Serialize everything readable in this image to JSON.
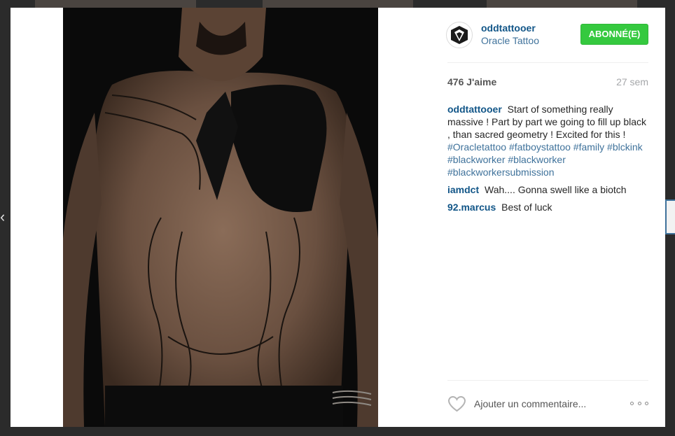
{
  "post": {
    "username": "oddtattooer",
    "location": "Oracle Tattoo",
    "follow_label": "ABONNÉ(E)",
    "likes": "476 J'aime",
    "time": "27 sem",
    "caption": {
      "user": "oddtattooer",
      "text": "Start of something really massive ! Part by part we going to fill up black , than sacred geometry ! Excited for this !",
      "hashtags": [
        "#Oracletattoo",
        "#fatboystattoo",
        "#family",
        "#blckink",
        "#blackworker",
        "#blackworker",
        "#blackworkersubmission"
      ]
    },
    "comments": [
      {
        "user": "iamdct",
        "text": "Wah.... Gonna swell like a biotch"
      },
      {
        "user": "92.marcus",
        "text": "Best of luck"
      }
    ],
    "comment_placeholder": "Ajouter un commentaire..."
  },
  "colors": {
    "username": "#125688",
    "hashtag": "#3f729b",
    "follow_bg": "#35c93f"
  },
  "icons": [
    "avatar-logo-icon",
    "heart-icon",
    "more-options-icon",
    "previous-arrow-icon"
  ]
}
